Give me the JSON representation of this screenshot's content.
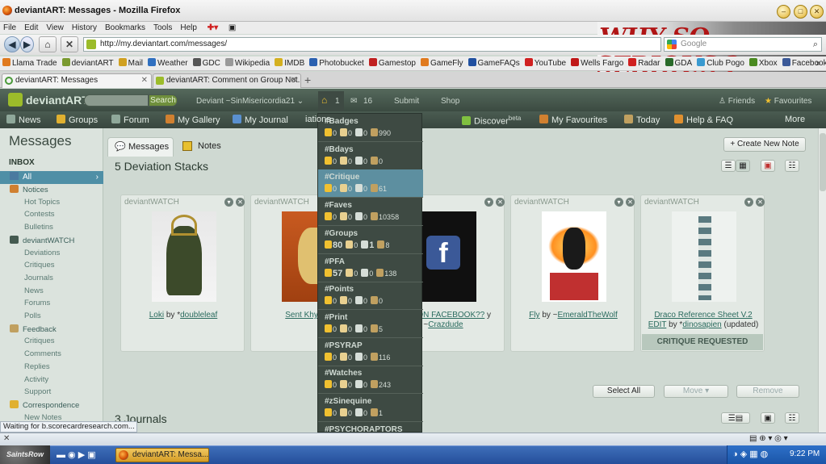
{
  "window": {
    "title": "deviantART: Messages - Mozilla Firefox"
  },
  "menubar": [
    "File",
    "Edit",
    "View",
    "History",
    "Bookmarks",
    "Tools",
    "Help"
  ],
  "banner": {
    "text": "WHY SO SERIOUS ?"
  },
  "navbar": {
    "url": "http://my.deviantart.com/messages/",
    "search_placeholder": "Google"
  },
  "bookmarks": [
    {
      "label": "Llama Trade",
      "color": "#e07a1f"
    },
    {
      "label": "deviantART",
      "color": "#7a9a30"
    },
    {
      "label": "Mail",
      "color": "#d0a020"
    },
    {
      "label": "Weather",
      "color": "#3070c0"
    },
    {
      "label": "GDC",
      "color": "#555555"
    },
    {
      "label": "Wikipedia",
      "color": "#999999"
    },
    {
      "label": "IMDB",
      "color": "#d4b020"
    },
    {
      "label": "Photobucket",
      "color": "#2a60b0"
    },
    {
      "label": "Gamestop",
      "color": "#c02020"
    },
    {
      "label": "GameFly",
      "color": "#e07a1f"
    },
    {
      "label": "GameFAQs",
      "color": "#2050a0"
    },
    {
      "label": "YouTube",
      "color": "#d02020"
    },
    {
      "label": "Wells Fargo",
      "color": "#c01818"
    },
    {
      "label": "Radar",
      "color": "#d02020"
    },
    {
      "label": "GDA",
      "color": "#2a6a2a"
    },
    {
      "label": "Club Pogo",
      "color": "#3a9ad0"
    },
    {
      "label": "Xbox",
      "color": "#4a8a20"
    },
    {
      "label": "Facebook",
      "color": "#3b5998"
    }
  ],
  "tabs": [
    {
      "label": "deviantART: Messages",
      "active": true
    },
    {
      "label": "deviantART: Comment on Group Not...",
      "active": false
    }
  ],
  "da_top": {
    "logo": "deviantART",
    "search_btn": "Search",
    "user": "Deviant ~SinMisericordia21",
    "home_count": "1",
    "mail_count": "16",
    "submit": "Submit",
    "shop": "Shop",
    "friends": "Friends",
    "favourites": "Favourites"
  },
  "da_nav": [
    {
      "label": "News",
      "color": "#8fa89a"
    },
    {
      "label": "Groups",
      "color": "#e0b030"
    },
    {
      "label": "Forum",
      "color": "#8fa89a"
    },
    {
      "label": "My Gallery",
      "color": "#d08030"
    },
    {
      "label": "My Journal",
      "color": "#5a90d0"
    },
    {
      "label": "iations",
      "color": ""
    },
    {
      "label": "Discover",
      "sup": "beta",
      "color": "#80c040"
    },
    {
      "label": "My Favourites",
      "color": "#d08030"
    },
    {
      "label": "Today",
      "color": "#c0a060"
    },
    {
      "label": "Help & FAQ",
      "color": "#e09030"
    },
    {
      "label": "More",
      "color": ""
    }
  ],
  "sidebar": {
    "heading": "Messages",
    "inbox_label": "INBOX",
    "items": [
      {
        "label": "All",
        "level": 0,
        "color": "#4a7aa0"
      },
      {
        "label": "Notices",
        "level": 0,
        "color": "#d08030"
      },
      {
        "label": "Hot Topics",
        "level": 1
      },
      {
        "label": "Contests",
        "level": 1
      },
      {
        "label": "Bulletins",
        "level": 1
      },
      {
        "label": "deviantWATCH",
        "level": 0,
        "color": "#445a50"
      },
      {
        "label": "Deviations",
        "level": 1
      },
      {
        "label": "Critiques",
        "level": 1
      },
      {
        "label": "Journals",
        "level": 1
      },
      {
        "label": "News",
        "level": 1
      },
      {
        "label": "Forums",
        "level": 1
      },
      {
        "label": "Polls",
        "level": 1
      },
      {
        "label": "Feedback",
        "level": 0,
        "color": "#c0a060"
      },
      {
        "label": "Critiques",
        "level": 1
      },
      {
        "label": "Comments",
        "level": 1
      },
      {
        "label": "Replies",
        "level": 1
      },
      {
        "label": "Activity",
        "level": 1
      },
      {
        "label": "Support",
        "level": 1
      },
      {
        "label": "Correspondence",
        "level": 0,
        "color": "#e0b030"
      },
      {
        "label": "New Notes",
        "level": 1
      }
    ]
  },
  "content": {
    "tab_messages": "Messages",
    "tab_notes": "Notes",
    "create_note": "+ Create New Note",
    "stacks_title": "5 Deviation Stacks",
    "journals_title": "3 Journals",
    "select_all": "Select All",
    "move": "Move ▾",
    "remove": "Remove",
    "cards": [
      {
        "source": "deviantWATCH",
        "title": "Loki",
        "by": "by *",
        "author": "doubleleaf",
        "extra": "",
        "badge": ""
      },
      {
        "source": "deviantWATCH",
        "title": "Sent Khyterra b",
        "by": "",
        "author": "",
        "extra": "",
        "badge": ""
      },
      {
        "source": "TCH",
        "title": "HO'S ON FACEBOOK??",
        "by": "y ~",
        "author": "Crazdude",
        "extra": "",
        "badge": ""
      },
      {
        "source": "deviantWATCH",
        "title": "Fly",
        "by": "by ~",
        "author": "EmeraldTheWolf",
        "extra": "",
        "badge": ""
      },
      {
        "source": "deviantWATCH",
        "title": "Draco Reference Sheet V.2 EDIT",
        "by": "by *",
        "author": "dinosapien",
        "extra": "(updated)",
        "badge": "CRITIQUE REQUESTED"
      }
    ]
  },
  "dropdown": [
    {
      "name": "#Badges",
      "a": "0",
      "b": "0",
      "c": "0",
      "d": "990",
      "bold": false
    },
    {
      "name": "#Bdays",
      "a": "0",
      "b": "0",
      "c": "0",
      "d": "0",
      "bold": false
    },
    {
      "name": "#Critique",
      "a": "0",
      "b": "0",
      "c": "0",
      "d": "61",
      "bold": false,
      "selected": true
    },
    {
      "name": "#Faves",
      "a": "0",
      "b": "0",
      "c": "0",
      "d": "10358",
      "bold": false
    },
    {
      "name": "#Groups",
      "a": "80",
      "b": "0",
      "c": "1",
      "d": "8",
      "bold": true
    },
    {
      "name": "#PFA",
      "a": "57",
      "b": "0",
      "c": "0",
      "d": "138",
      "bold": true
    },
    {
      "name": "#Points",
      "a": "0",
      "b": "0",
      "c": "0",
      "d": "0",
      "bold": false
    },
    {
      "name": "#Print",
      "a": "0",
      "b": "0",
      "c": "0",
      "d": "5",
      "bold": false
    },
    {
      "name": "#PSYRAP",
      "a": "0",
      "b": "0",
      "c": "0",
      "d": "116",
      "bold": false
    },
    {
      "name": "#Watches",
      "a": "0",
      "b": "0",
      "c": "0",
      "d": "243",
      "bold": false
    },
    {
      "name": "#zSinequine",
      "a": "0",
      "b": "0",
      "c": "0",
      "d": "1",
      "bold": false
    },
    {
      "name": "#PSYCHORAPTORS",
      "a": "",
      "b": "",
      "c": "",
      "d": "",
      "bold": false
    }
  ],
  "status": {
    "text": "Waiting for b.scorecardresearch.com..."
  },
  "taskbar": {
    "start": "SaintsRow",
    "item": "deviantART: Messa...",
    "clock": "9:22 PM"
  }
}
